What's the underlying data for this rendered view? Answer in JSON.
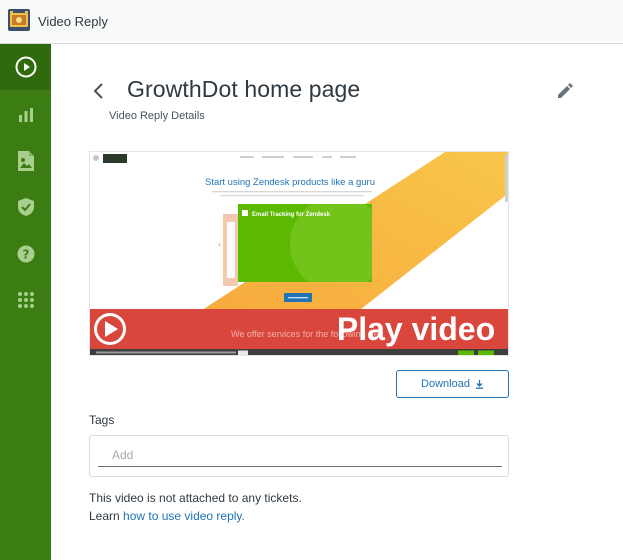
{
  "app": {
    "title": "Video Reply",
    "logo_icon": "video-reply-logo-icon"
  },
  "sidebar": {
    "background": "#3b7d13",
    "items": [
      {
        "id": "videos",
        "icon": "play-circle-icon",
        "active": true
      },
      {
        "id": "stats",
        "icon": "bar-chart-icon",
        "active": false
      },
      {
        "id": "image",
        "icon": "image-file-icon",
        "active": false
      },
      {
        "id": "security",
        "icon": "shield-check-icon",
        "active": false
      },
      {
        "id": "help",
        "icon": "help-circle-icon",
        "active": false
      },
      {
        "id": "apps",
        "icon": "grid-dots-icon",
        "active": false
      }
    ]
  },
  "header": {
    "title": "GrowthDot home page",
    "subtitle": "Video Reply Details",
    "back_icon": "chevron-left-icon",
    "edit_icon": "pencil-icon"
  },
  "thumbnail": {
    "website_heading": "Start using Zendesk products like a guru",
    "card_title": "Email Tracking for Zendesk",
    "play_label": "Play video",
    "footer_text": "We offer services for the following Ze",
    "colors": {
      "orange": "#f7b733",
      "green": "#5cb800",
      "banner": "#d9463c",
      "heading": "#1f73b7"
    }
  },
  "download": {
    "label": "Download",
    "icon": "download-arrow-icon"
  },
  "tags": {
    "label": "Tags",
    "placeholder": "Add",
    "value": ""
  },
  "note": {
    "text": "This video is not attached to any tickets.",
    "learn_prefix": "Learn ",
    "learn_link": "how to use video reply."
  }
}
